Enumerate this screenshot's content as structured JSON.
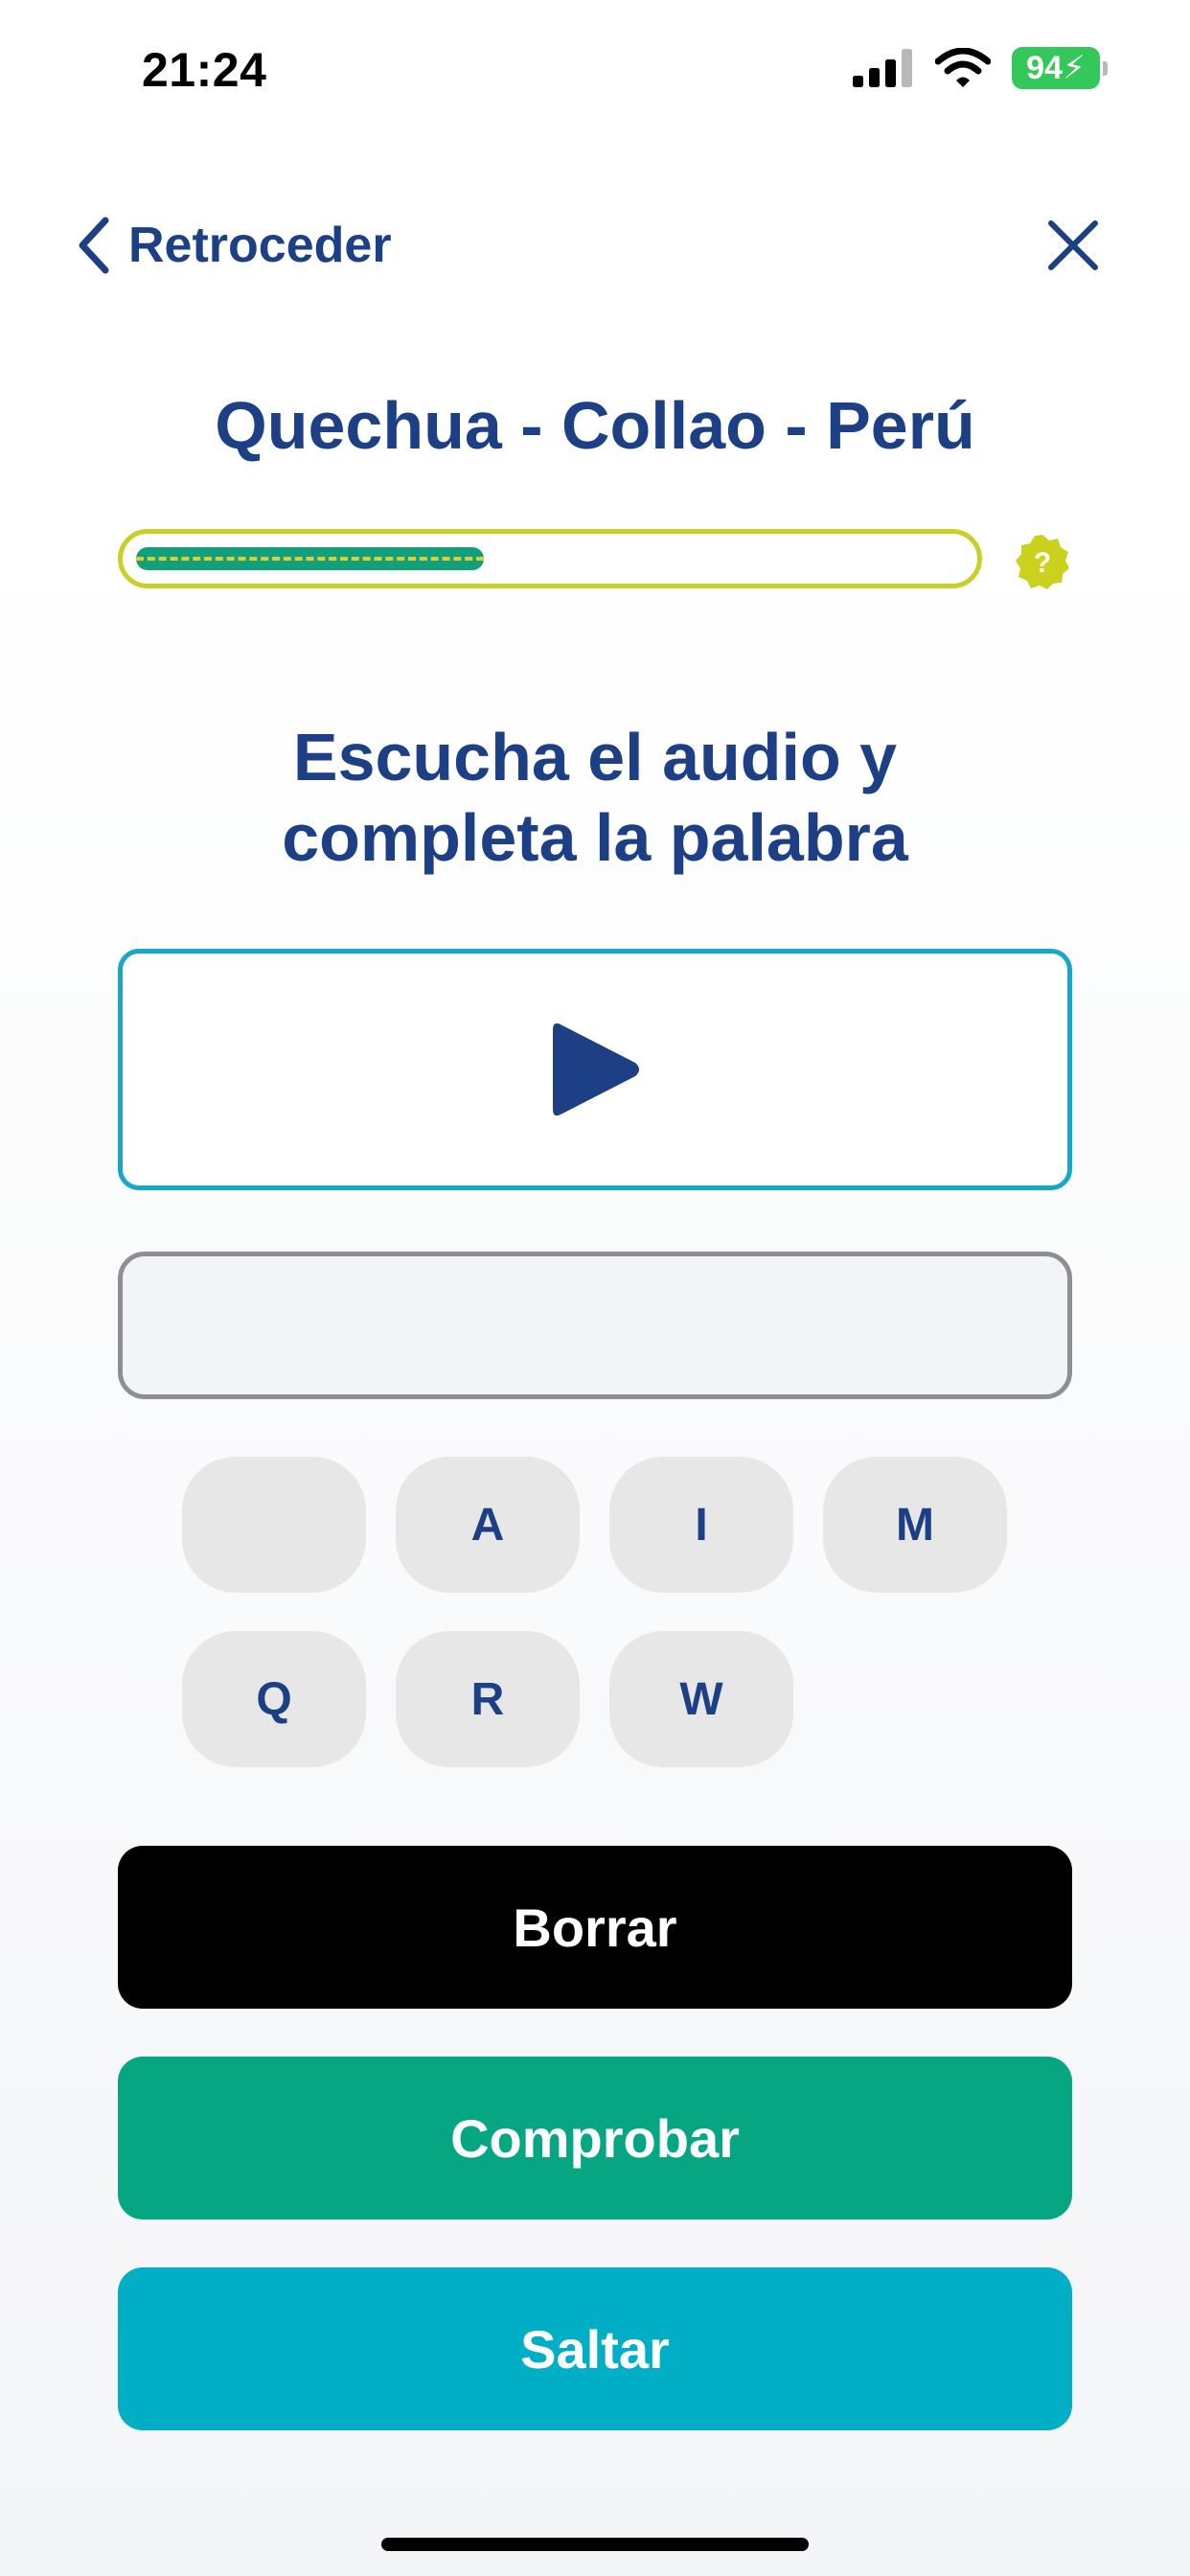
{
  "status_bar": {
    "time": "21:24",
    "battery": "94",
    "icons": [
      "signal-icon",
      "wifi-icon",
      "battery-charging-icon"
    ]
  },
  "nav": {
    "back_label": "Retroceder",
    "back_icon": "chevron-left-icon",
    "close_icon": "close-icon"
  },
  "lesson": {
    "title": "Quechua - Collao - Perú",
    "progress": 0.42,
    "help_icon": "question-badge-icon"
  },
  "exercise": {
    "instruction_line1": "Escucha el audio y",
    "instruction_line2": "completa la palabra",
    "play_icon": "play-icon",
    "answer": ""
  },
  "letters": [
    "",
    "A",
    "I",
    "M",
    "Q",
    "R",
    "W"
  ],
  "buttons": {
    "clear": "Borrar",
    "check": "Comprobar",
    "skip": "Saltar"
  },
  "colors": {
    "primary_text": "#1c3f86",
    "progress_border": "#c8d028",
    "progress_fill": "#10a07c",
    "audio_border": "#16a8c9",
    "clear_button": "#000000",
    "check_button": "#07a683",
    "skip_button": "#00aec6"
  }
}
